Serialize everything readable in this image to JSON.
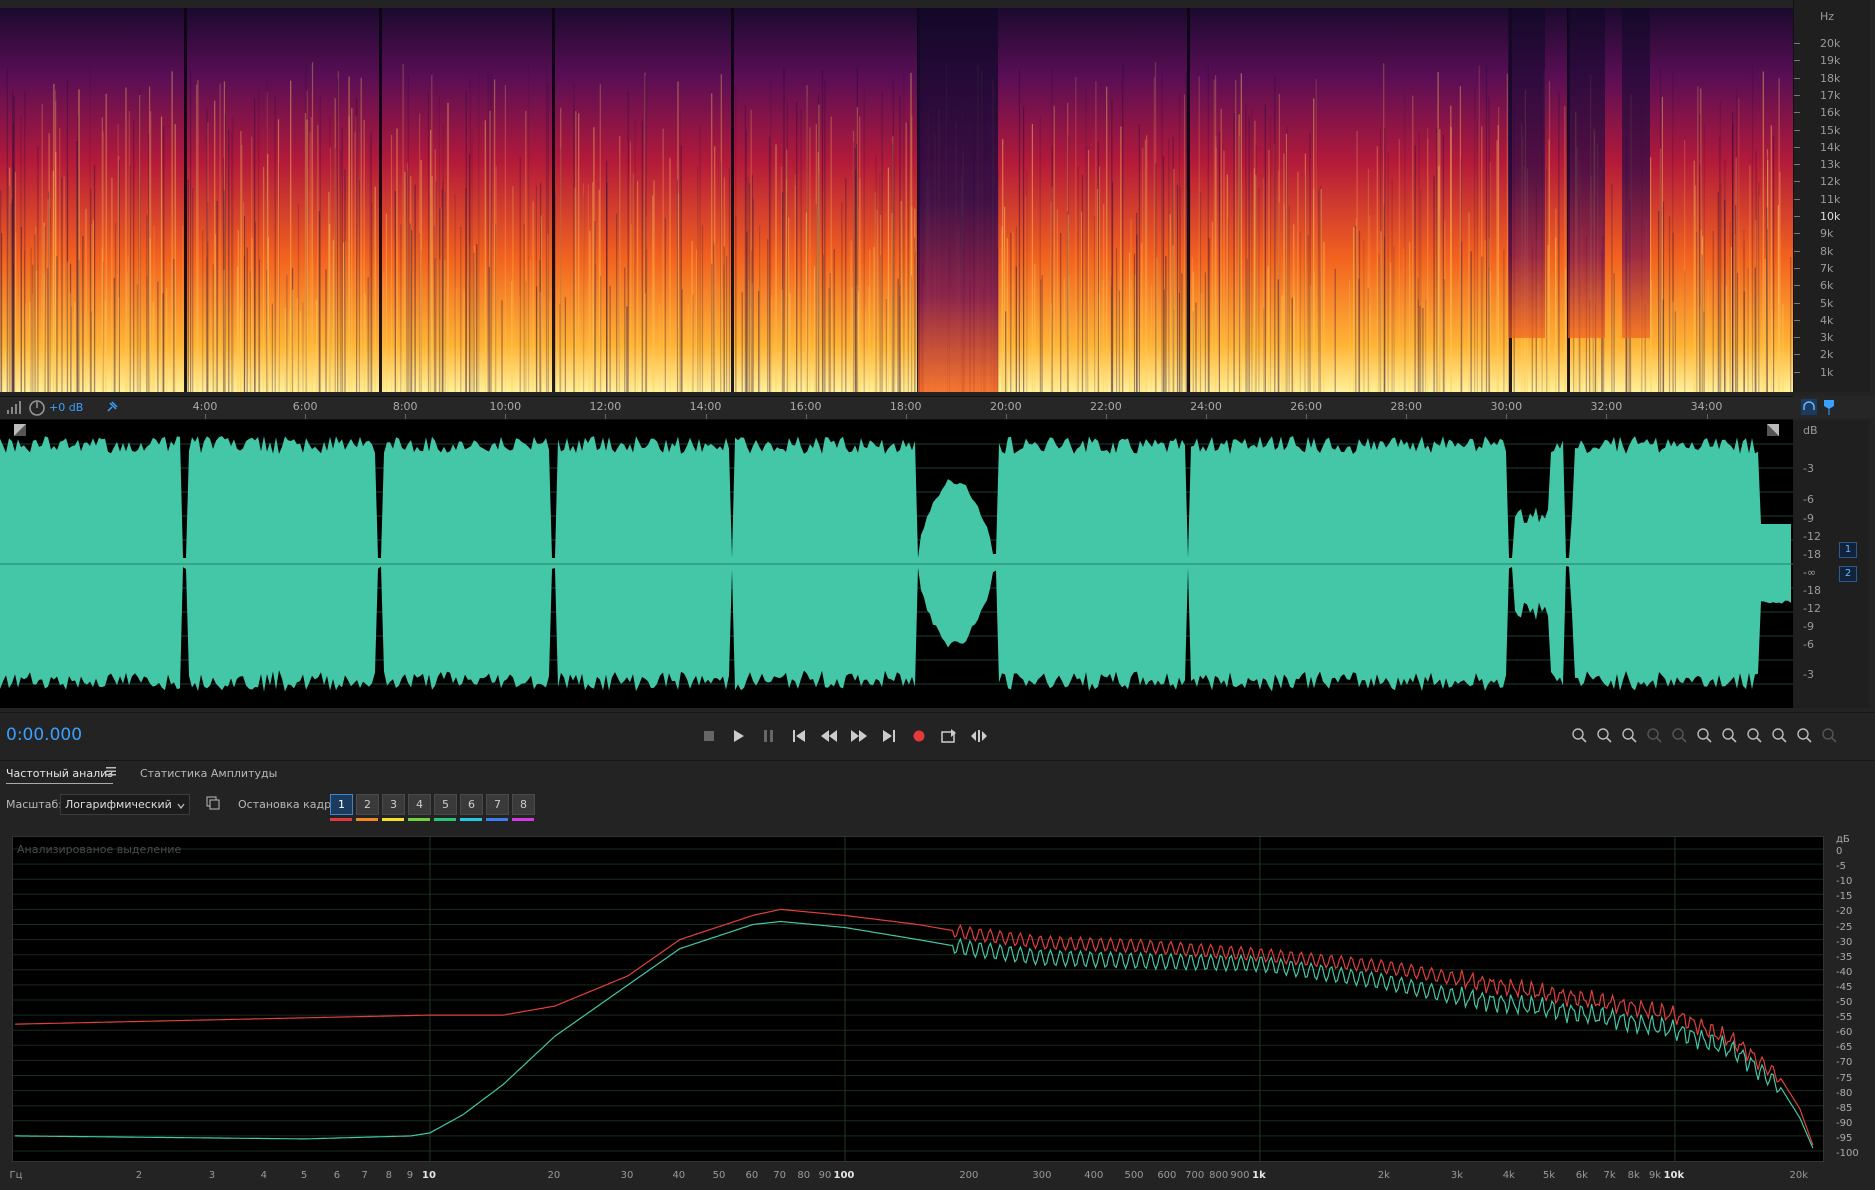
{
  "spectral": {
    "hz_unit": "Hz",
    "hz_labels": [
      "20k",
      "19k",
      "18k",
      "17k",
      "16k",
      "15k",
      "14k",
      "13k",
      "12k",
      "11k",
      "10k",
      "9k",
      "8k",
      "7k",
      "6k",
      "5k",
      "4k",
      "3k",
      "2k",
      "1k"
    ]
  },
  "timeline": {
    "gain": "+0 dB",
    "labels": [
      "4:00",
      "6:00",
      "8:00",
      "10:00",
      "12:00",
      "14:00",
      "16:00",
      "18:00",
      "20:00",
      "22:00",
      "24:00",
      "26:00",
      "28:00",
      "30:00",
      "32:00",
      "34:00"
    ]
  },
  "waveform": {
    "db_unit": "dB",
    "db_labels": [
      "-3",
      "-6",
      "-9",
      "-12",
      "-18",
      "-∞",
      "-18",
      "-12",
      "-9",
      "-6",
      "-3"
    ],
    "channels": [
      "1",
      "2"
    ],
    "colors": {
      "wave": "#44c7a6",
      "background": "#000000"
    }
  },
  "transport": {
    "time": "0:00.000",
    "icons": [
      "stop-icon",
      "play-icon",
      "pause-icon",
      "go-to-start-icon",
      "rewind-icon",
      "fast-forward-icon",
      "go-to-end-icon",
      "record-icon",
      "loop-icon",
      "skip-icon"
    ],
    "zoom_icons": [
      "zoom-in-amplitude-icon",
      "zoom-out-amplitude-icon",
      "zoom-reset-icon",
      "zoom-in-time-icon",
      "zoom-out-time-icon",
      "zoom-selection-icon",
      "zoom-in-left-icon",
      "zoom-in-right-icon",
      "zoom-full-icon",
      "zoom-out-full-icon",
      "zoom-disabled-icon"
    ]
  },
  "panel": {
    "tabs": [
      "Частотный анализ",
      "Статистика Амплитуды"
    ],
    "scale_label": "Масштаб:",
    "scale_value": "Логарифмический",
    "freeze_label": "Остановка кадра:",
    "freeze_buttons": [
      "1",
      "2",
      "3",
      "4",
      "5",
      "6",
      "7",
      "8"
    ],
    "freeze_colors": [
      "#e23a3a",
      "#f08a20",
      "#f2e22a",
      "#6fd23a",
      "#29c47a",
      "#26c8e8",
      "#3a7ff0",
      "#d23ae0"
    ]
  },
  "chart_data": {
    "type": "line",
    "title": "Анализированое выделение",
    "x_scale": "log",
    "xlim": [
      1,
      22000
    ],
    "ylim": [
      -100,
      0
    ],
    "y_unit": "дБ",
    "x_unit": "Гц",
    "x_ticks": [
      "2",
      "3",
      "4",
      "5",
      "6",
      "7",
      "8",
      "9",
      "10",
      "20",
      "30",
      "40",
      "50",
      "60",
      "70",
      "80",
      "90",
      "100",
      "200",
      "300",
      "400",
      "500",
      "600",
      "700",
      "800",
      "900",
      "1k",
      "2k",
      "3k",
      "4k",
      "5k",
      "6k",
      "7k",
      "8k",
      "9k",
      "10k",
      "20k"
    ],
    "x_tick_values": [
      2,
      3,
      4,
      5,
      6,
      7,
      8,
      9,
      10,
      20,
      30,
      40,
      50,
      60,
      70,
      80,
      90,
      100,
      200,
      300,
      400,
      500,
      600,
      700,
      800,
      900,
      1000,
      2000,
      3000,
      4000,
      5000,
      6000,
      7000,
      8000,
      9000,
      10000,
      20000
    ],
    "y_ticks": [
      "0",
      "-5",
      "-10",
      "-15",
      "-20",
      "-25",
      "-30",
      "-35",
      "-40",
      "-45",
      "-50",
      "-55",
      "-60",
      "-65",
      "-70",
      "-75",
      "-80",
      "-85",
      "-90",
      "-95",
      "-100"
    ],
    "grid": true,
    "series": [
      {
        "color": "#e0403a",
        "x": [
          1,
          10,
          15,
          20,
          30,
          40,
          60,
          70,
          100,
          150,
          200,
          300,
          500,
          1000,
          2000,
          3000,
          5000,
          7000,
          10000,
          14000,
          18000,
          20000,
          21500
        ],
        "y": [
          -58,
          -55,
          -55,
          -52,
          -42,
          -30,
          -22,
          -20,
          -22,
          -25,
          -28,
          -31,
          -32,
          -35,
          -39,
          -43,
          -48,
          -51,
          -55,
          -64,
          -76,
          -86,
          -98
        ]
      },
      {
        "color": "#44c7a6",
        "x": [
          1,
          5,
          9,
          10,
          12,
          15,
          20,
          30,
          40,
          60,
          70,
          100,
          150,
          200,
          300,
          500,
          1000,
          2000,
          3000,
          5000,
          7000,
          10000,
          14000,
          18000,
          20000,
          21500
        ],
        "y": [
          -95,
          -96,
          -95,
          -94,
          -88,
          -78,
          -62,
          -45,
          -33,
          -25,
          -24,
          -26,
          -30,
          -33,
          -36,
          -37,
          -38,
          -44,
          -49,
          -53,
          -56,
          -60,
          -67,
          -79,
          -89,
          -99
        ]
      }
    ]
  }
}
